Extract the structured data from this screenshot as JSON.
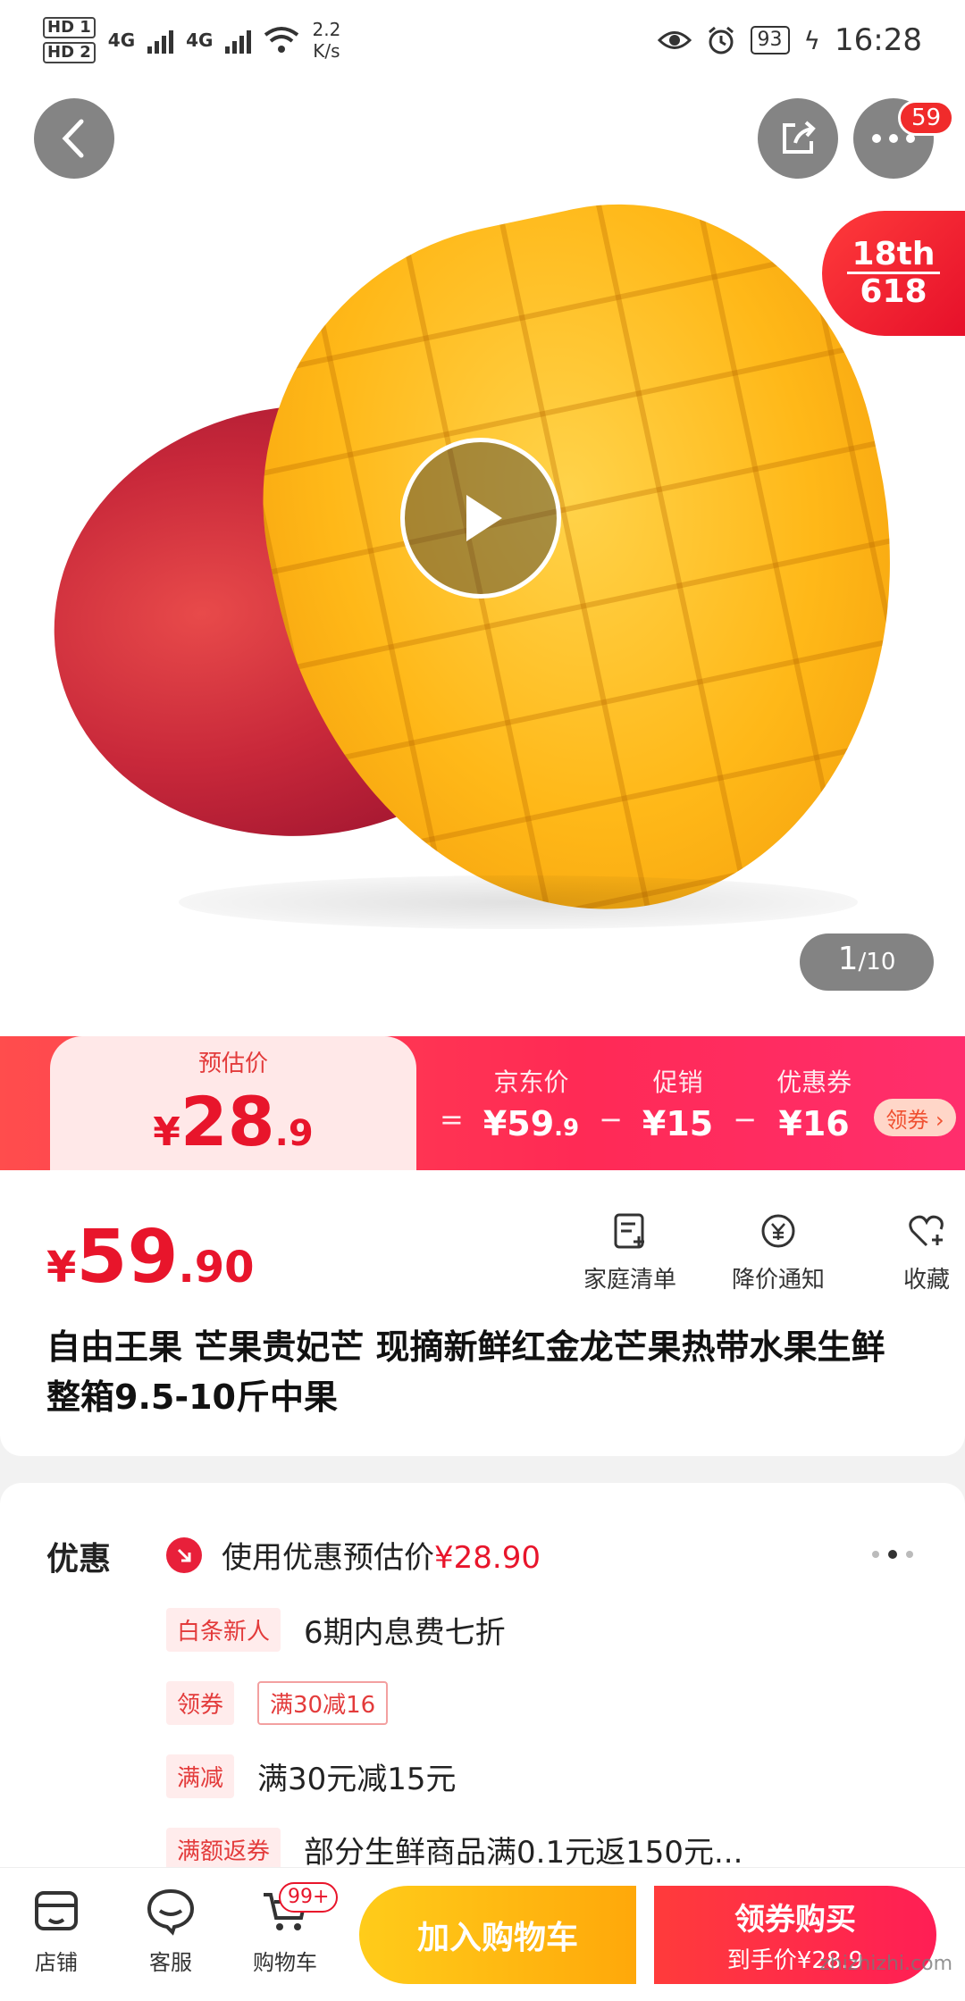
{
  "status_bar": {
    "sim1": "HD 1",
    "sim2": "HD 2",
    "net1": "4G",
    "net2": "4G",
    "speed_value": "2.2",
    "speed_unit": "K/s",
    "battery": "93",
    "time": "16:28"
  },
  "header": {
    "more_badge": "59",
    "anniversary_top": "18th",
    "anniversary_bottom": "618"
  },
  "gallery": {
    "current": "1",
    "total": "/10"
  },
  "price_banner": {
    "estimate_label": "预估价",
    "estimate_symbol": "¥",
    "estimate_int": "28",
    "estimate_dec": ".9",
    "eq": "=",
    "minus": "−",
    "jd_label": "京东价",
    "jd_value": "¥59",
    "jd_value_dec": ".9",
    "promo_label": "促销",
    "promo_value": "¥15",
    "coupon_label": "优惠券",
    "coupon_value": "¥16",
    "coupon_button": "领券 ›"
  },
  "product": {
    "price_symbol": "¥",
    "price_int": "59",
    "price_dec": ".90",
    "actions": [
      {
        "label": "家庭清单",
        "icon": "list-add-icon"
      },
      {
        "label": "降价通知",
        "icon": "price-alert-icon"
      },
      {
        "label": "收藏",
        "icon": "heart-add-icon"
      }
    ],
    "title": "自由王果 芒果贵妃芒 现摘新鲜红金龙芒果热带水果生鲜 整箱9.5-10斤中果"
  },
  "promotions": {
    "heading": "优惠",
    "estimate_text": "使用优惠预估价",
    "estimate_price": "¥28.90",
    "rows": [
      {
        "tag": "白条新人",
        "text": "6期内息费七折"
      },
      {
        "tag": "领券",
        "text": "满30减16"
      },
      {
        "tag": "满减",
        "text": "满30元减15元"
      },
      {
        "tag": "满额返券",
        "text": "部分生鲜商品满0.1元返150元..."
      }
    ]
  },
  "bottom_bar": {
    "store": "店铺",
    "service": "客服",
    "cart": "购物车",
    "cart_badge": "99+",
    "add_to_cart": "加入购物车",
    "buy_title": "领券购买",
    "buy_sub": "到手价¥28.9"
  },
  "watermark": "zhizhizhi.com",
  "colors": {
    "accent_red": "#e8152b",
    "cart_yellow": "#ffb818",
    "banner_pink": "#ff2a55"
  }
}
